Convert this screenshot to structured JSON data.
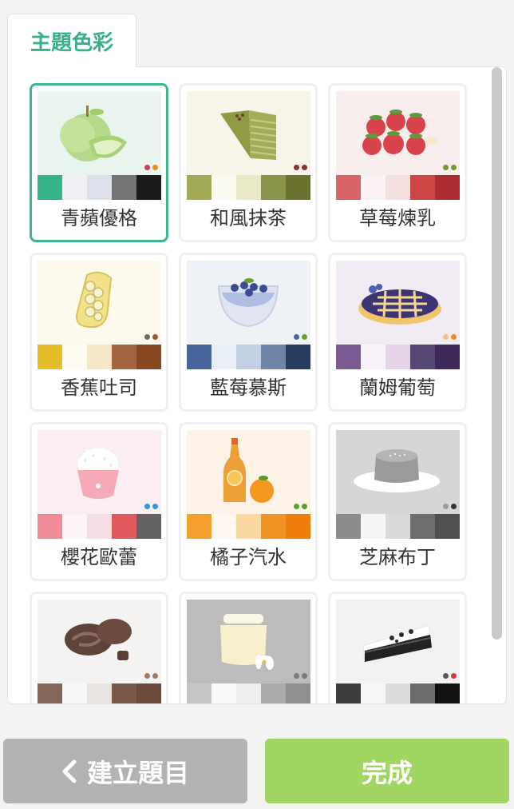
{
  "tab": {
    "label": "主題色彩"
  },
  "themes": [
    {
      "label": "青蘋優格",
      "bg": "#eaf4ef",
      "dots": [
        "#d8365a",
        "#f08a1c"
      ],
      "swatches": [
        "#35b38a",
        "#f1f1f5",
        "#dddfeb",
        "#747474",
        "#1b1b1b"
      ],
      "selected": true
    },
    {
      "label": "和風抹茶",
      "bg": "#f6f5e8",
      "dots": [
        "#8a2f3f",
        "#8a2f3f"
      ],
      "swatches": [
        "#a2a957",
        "#fbfaf1",
        "#e9e8c7",
        "#8b9549",
        "#6b7230"
      ],
      "selected": false
    },
    {
      "label": "草莓煉乳",
      "bg": "#f8eded",
      "dots": [
        "#6a9d2d",
        "#6a9d2d"
      ],
      "swatches": [
        "#d96466",
        "#fbf3f3",
        "#f5e0e0",
        "#cc4646",
        "#ad2e32"
      ],
      "selected": false
    },
    {
      "label": "香蕉吐司",
      "bg": "#fdf9ec",
      "dots": [
        "#6b6b6b",
        "#9a5a36"
      ],
      "swatches": [
        "#e5be2a",
        "#fefbf0",
        "#f6e7c7",
        "#a2653f",
        "#87471f"
      ],
      "selected": false
    },
    {
      "label": "藍莓慕斯",
      "bg": "#eef1f6",
      "dots": [
        "#4a6797",
        "#6aa22c"
      ],
      "swatches": [
        "#47659a",
        "#e8eef6",
        "#c2d0e5",
        "#6e84a9",
        "#263d60"
      ],
      "selected": false
    },
    {
      "label": "蘭姆葡萄",
      "bg": "#f1ecf3",
      "dots": [
        "#f0c770",
        "#f08a1c"
      ],
      "swatches": [
        "#7b5a94",
        "#f8f3fa",
        "#e6d3e8",
        "#574777",
        "#3d2859"
      ],
      "selected": false
    },
    {
      "label": "櫻花歐蕾",
      "bg": "#fbeef2",
      "dots": [
        "#2b9bd6",
        "#2b9bd6"
      ],
      "swatches": [
        "#f28b98",
        "#fdf5f7",
        "#f6dde3",
        "#e05a5c",
        "#626262"
      ],
      "selected": false
    },
    {
      "label": "橘子汽水",
      "bg": "#fdf2e6",
      "dots": [
        "#56a02c",
        "#56a02c"
      ],
      "swatches": [
        "#f3a02c",
        "#fef8f0",
        "#fbd7a2",
        "#f09324",
        "#f07e0c"
      ],
      "selected": false
    },
    {
      "label": "芝麻布丁",
      "bg": "#d6d6d6",
      "dots": [
        "#9b9b9b",
        "#333333"
      ],
      "swatches": [
        "#8c8c8c",
        "#f5f5f5",
        "#dadada",
        "#6e6e6e",
        "#505050"
      ],
      "selected": false
    },
    {
      "label": "",
      "bg": "#f5f3f2",
      "dots": [
        "#a37865",
        "#a37865"
      ],
      "swatches": [
        "#846558",
        "#faf8f7",
        "#e8e4e2",
        "#7a5848",
        "#6b4a3a"
      ],
      "selected": false
    },
    {
      "label": "",
      "bg": "#bcbcbc",
      "dots": [
        "#7a7a7a",
        "#7a7a7a"
      ],
      "swatches": [
        "#c5c5c5",
        "#fafafa",
        "#eeeeee",
        "#aaaaaa",
        "#8f8f8f"
      ],
      "selected": false
    },
    {
      "label": "",
      "bg": "#f2f2f2",
      "dots": [
        "#5a5a5a",
        "#d63a3a"
      ],
      "swatches": [
        "#3c3c3c",
        "#f7f7f7",
        "#dddddd",
        "#6b6b6b",
        "#111111"
      ],
      "selected": false
    }
  ],
  "buttons": {
    "back_label": "建立題目",
    "done_label": "完成"
  }
}
